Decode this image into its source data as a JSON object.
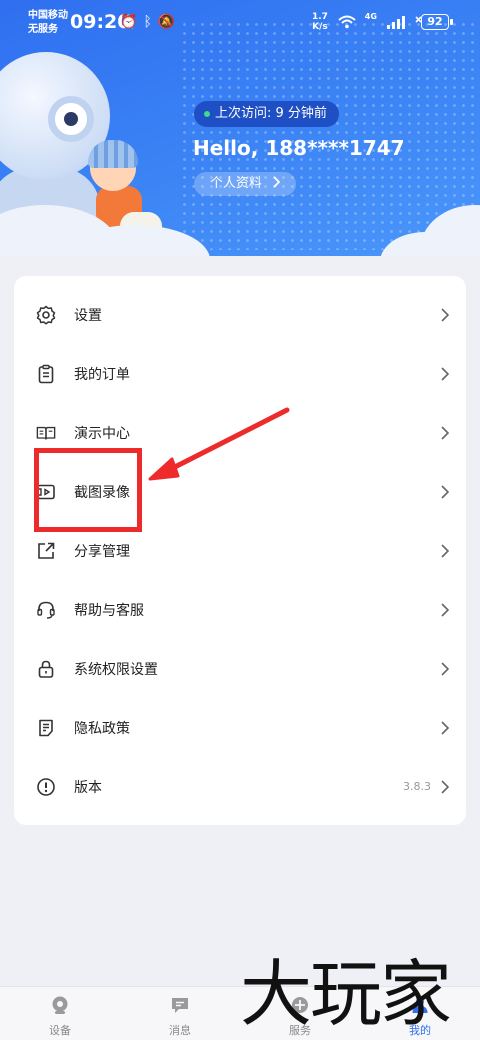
{
  "status_bar": {
    "carrier_line1": "中国移动",
    "carrier_line2": "无服务",
    "time": "09:20",
    "net_speed_value": "1.7",
    "net_speed_unit": "K/s",
    "network_type": "4G",
    "battery": "92"
  },
  "header": {
    "last_visit": "上次访问: 9 分钟前",
    "greeting": "Hello, 188****1747",
    "profile_button": "个人资料"
  },
  "menu": {
    "items": [
      {
        "label": "设置",
        "icon": "gear-icon"
      },
      {
        "label": "我的订单",
        "icon": "clipboard-icon"
      },
      {
        "label": "演示中心",
        "icon": "book-icon"
      },
      {
        "label": "截图录像",
        "icon": "video-icon"
      },
      {
        "label": "分享管理",
        "icon": "share-icon"
      },
      {
        "label": "帮助与客服",
        "icon": "headset-icon"
      },
      {
        "label": "系统权限设置",
        "icon": "lock-icon"
      },
      {
        "label": "隐私政策",
        "icon": "document-icon"
      },
      {
        "label": "版本",
        "icon": "info-icon",
        "value": "3.8.3"
      }
    ]
  },
  "bottom_nav": {
    "tabs": [
      {
        "label": "设备",
        "icon": "camera-icon"
      },
      {
        "label": "消息",
        "icon": "message-icon"
      },
      {
        "label": "服务",
        "icon": "service-icon"
      },
      {
        "label": "我的",
        "icon": "user-icon",
        "active": true
      }
    ]
  },
  "watermark": "大玩家",
  "colors": {
    "accent": "#2f6ff0",
    "annotation_red": "#ee2b2b",
    "online_dot": "#41d98d"
  }
}
